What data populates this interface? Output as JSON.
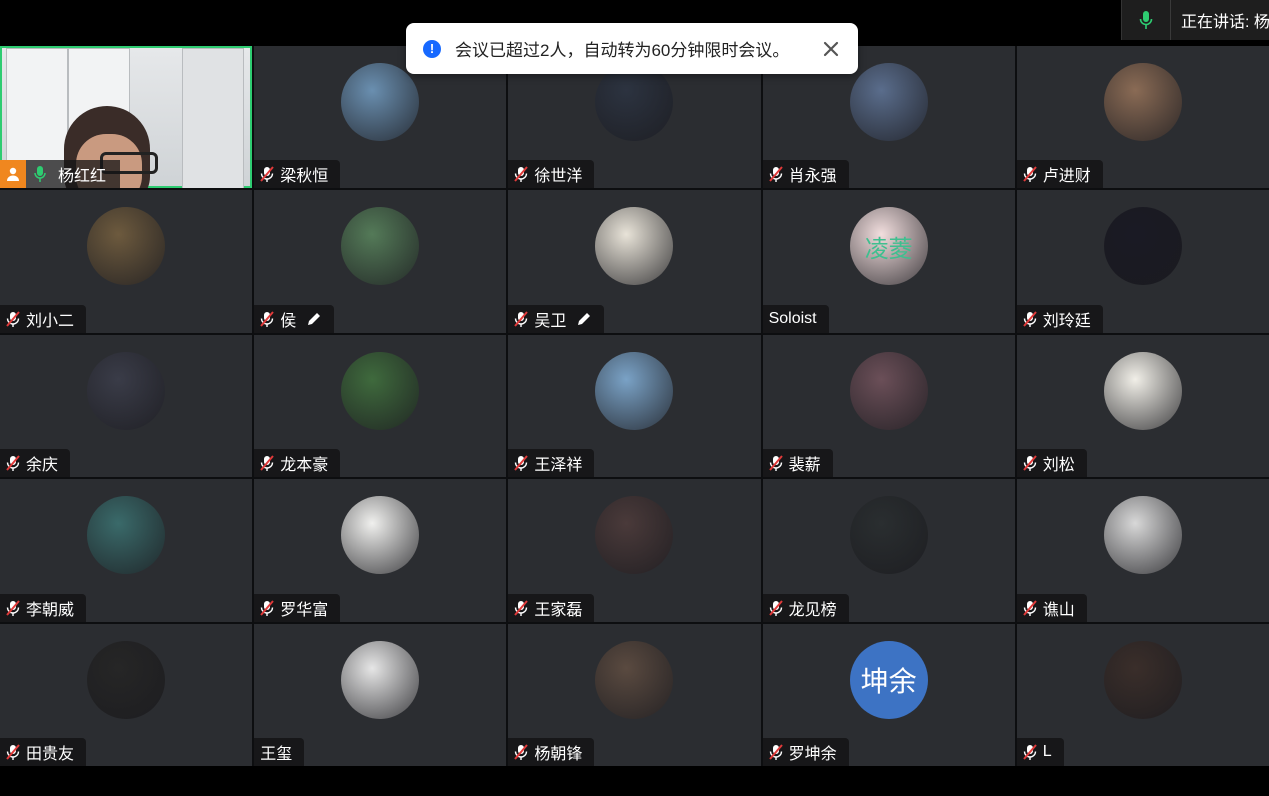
{
  "notice": {
    "text": "会议已超过2人，自动转为60分钟限时会议。"
  },
  "speaking": {
    "label": "正在讲话: 杨"
  },
  "self": {
    "name": "杨红红"
  },
  "avatar_colors": [
    "#6a8fb0",
    "#2c3340",
    "#5a6d8c",
    "#8a6b55",
    "#6d5a3e",
    "#547a58",
    "#e8e3d8",
    "#f2dede",
    "#1a1a24",
    "#3a3c48",
    "#3f6a3d",
    "#7aa2c6",
    "#6b4f58",
    "#f1efe8",
    "#3a6a6a",
    "#f0f0ee",
    "#4a3a3a",
    "#2a2e30",
    "#d8d8d8",
    "#262626",
    "#e6e6e6",
    "#5a4a40",
    "#3d73c4",
    "#3a2e2a"
  ],
  "participants": [
    {
      "name": "梁秋恒",
      "muted": true,
      "avatar": "photo"
    },
    {
      "name": "徐世洋",
      "muted": true,
      "avatar": "photo"
    },
    {
      "name": "肖永强",
      "muted": true,
      "avatar": "photo"
    },
    {
      "name": "卢进财",
      "muted": true,
      "avatar": "photo"
    },
    {
      "name": "刘小二",
      "muted": true,
      "avatar": "photo"
    },
    {
      "name": "侯",
      "muted": true,
      "pen": true,
      "avatar": "photo"
    },
    {
      "name": "吴卫",
      "muted": true,
      "pen": true,
      "avatar": "photo"
    },
    {
      "name": "Soloist",
      "muted": false,
      "avatar": "photo",
      "avatar_text": "凌菱"
    },
    {
      "name": "刘玲廷",
      "muted": true,
      "avatar": "photo"
    },
    {
      "name": "余庆",
      "muted": true,
      "avatar": "photo"
    },
    {
      "name": "龙本豪",
      "muted": true,
      "avatar": "photo"
    },
    {
      "name": "王泽祥",
      "muted": true,
      "avatar": "photo"
    },
    {
      "name": "裴薪",
      "muted": true,
      "avatar": "photo"
    },
    {
      "name": "刘松",
      "muted": true,
      "avatar": "photo"
    },
    {
      "name": "李朝威",
      "muted": true,
      "avatar": "photo"
    },
    {
      "name": "罗华富",
      "muted": true,
      "avatar": "photo"
    },
    {
      "name": "王家磊",
      "muted": true,
      "avatar": "photo"
    },
    {
      "name": "龙见榜",
      "muted": true,
      "avatar": "photo"
    },
    {
      "name": "谯山",
      "muted": true,
      "avatar": "photo"
    },
    {
      "name": "田贵友",
      "muted": true,
      "avatar": "photo"
    },
    {
      "name": "王玺",
      "muted": false,
      "avatar": "photo"
    },
    {
      "name": "杨朝锋",
      "muted": true,
      "avatar": "photo"
    },
    {
      "name": "罗坤余",
      "muted": true,
      "avatar": "text",
      "avatar_text": "坤余"
    },
    {
      "name": "L",
      "muted": true,
      "avatar": "photo"
    }
  ]
}
